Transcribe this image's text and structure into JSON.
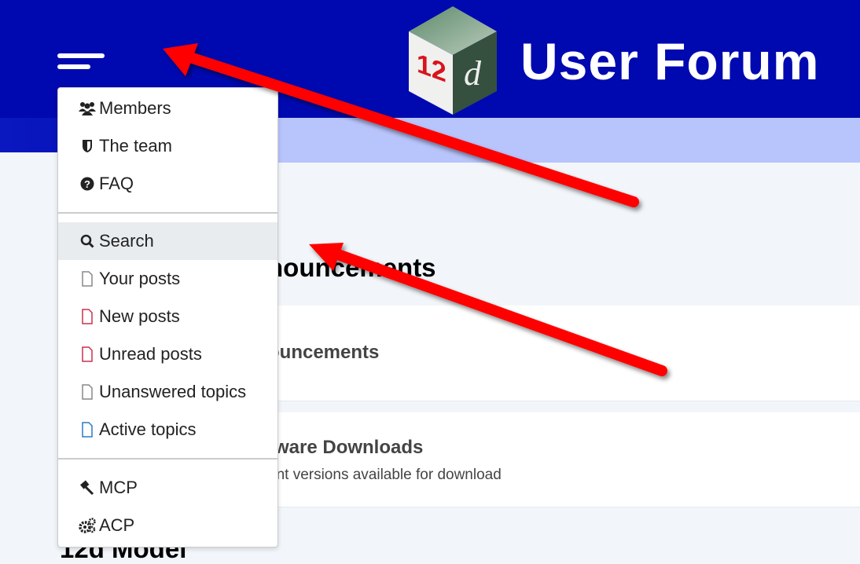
{
  "header": {
    "site_title": "User Forum",
    "logo_text": "12d",
    "brand_color": "#0009b0",
    "nav_color": "#b8c4fc"
  },
  "menu": {
    "items": [
      {
        "label": "Members",
        "icon": "users-icon"
      },
      {
        "label": "The team",
        "icon": "shield-icon"
      },
      {
        "label": "FAQ",
        "icon": "question-circle-icon"
      },
      {
        "label": "Search",
        "icon": "search-icon",
        "active": true
      },
      {
        "label": "Your posts",
        "icon": "file-icon"
      },
      {
        "label": "New posts",
        "icon": "file-icon-red"
      },
      {
        "label": "Unread posts",
        "icon": "file-icon-red"
      },
      {
        "label": "Unanswered topics",
        "icon": "file-icon"
      },
      {
        "label": "Active topics",
        "icon": "file-icon-blue"
      },
      {
        "label": "MCP",
        "icon": "gavel-icon"
      },
      {
        "label": "ACP",
        "icon": "cogs-icon"
      }
    ]
  },
  "content": {
    "section_heading": "nouncements",
    "forums": [
      {
        "title": "ouncements",
        "desc": ""
      },
      {
        "title": "tware Downloads",
        "desc": "ent versions available for download"
      }
    ],
    "section_heading_2": "12d Model"
  },
  "annotation": {
    "arrow_color": "#ff0000"
  }
}
